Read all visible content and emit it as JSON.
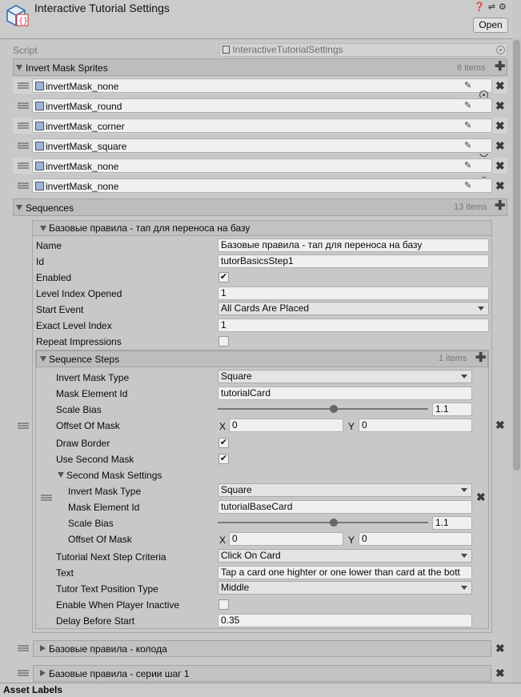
{
  "header": {
    "title": "Interactive Tutorial Settings",
    "open_label": "Open",
    "icons": [
      "help-icon",
      "preset-icon",
      "settings-icon"
    ]
  },
  "script_row": {
    "label": "Script",
    "value": "InteractiveTutorialSettings"
  },
  "invert_mask_sprites": {
    "title": "Invert Mask Sprites",
    "count": "6 items",
    "items": [
      "invertMask_none",
      "invertMask_round",
      "invertMask_corner",
      "invertMask_square",
      "invertMask_none",
      "invertMask_none"
    ]
  },
  "sequences": {
    "title": "Sequences",
    "count": "13 items",
    "element0": {
      "title": "Базовые правила - тап для переноса на базу",
      "name_label": "Name",
      "name_value": "Базовые правила - тап для переноса на базу",
      "id_label": "Id",
      "id_value": "tutorBasicsStep1",
      "enabled_label": "Enabled",
      "enabled": true,
      "level_index_label": "Level Index Opened",
      "level_index_value": "1",
      "start_event_label": "Start Event",
      "start_event_value": "All Cards Are Placed",
      "exact_level_label": "Exact Level Index",
      "exact_level_value": "1",
      "repeat_label": "Repeat Impressions",
      "repeat": false,
      "steps": {
        "title": "Sequence Steps",
        "count": "1 items",
        "invert_mask_type_label": "Invert Mask Type",
        "invert_mask_type_value": "Square",
        "mask_element_id_label": "Mask Element Id",
        "mask_element_id_value": "tutorialCard",
        "scale_bias_label": "Scale Bias",
        "scale_bias_value": "1.1",
        "scale_bias_fraction": 0.55,
        "offset_label": "Offset Of Mask",
        "offset_x_label": "X",
        "offset_x": "0",
        "offset_y_label": "Y",
        "offset_y": "0",
        "draw_border_label": "Draw Border",
        "draw_border": true,
        "use_second_mask_label": "Use Second Mask",
        "use_second_mask": true,
        "second_mask": {
          "title": "Second Mask Settings",
          "invert_mask_type_label": "Invert Mask Type",
          "invert_mask_type_value": "Square",
          "mask_element_id_label": "Mask Element Id",
          "mask_element_id_value": "tutorialBaseCard",
          "scale_bias_label": "Scale Bias",
          "scale_bias_value": "1.1",
          "scale_bias_fraction": 0.55,
          "offset_label": "Offset Of Mask",
          "offset_x_label": "X",
          "offset_x": "0",
          "offset_y_label": "Y",
          "offset_y": "0"
        },
        "next_step_label": "Tutorial Next Step Criteria",
        "next_step_value": "Click On Card",
        "text_label": "Text",
        "text_value": "Tap a card one highter or one lower than card at the bott",
        "tutor_pos_label": "Tutor Text Position Type",
        "tutor_pos_value": "Middle",
        "enable_inactive_label": "Enable When Player Inactive",
        "enable_inactive": false,
        "delay_label": "Delay Before Start",
        "delay_value": "0.35"
      }
    },
    "collapsed": [
      "Базовые правила - колода",
      "Базовые правила - серии шаг 1"
    ]
  },
  "footer": {
    "label": "Asset Labels"
  }
}
